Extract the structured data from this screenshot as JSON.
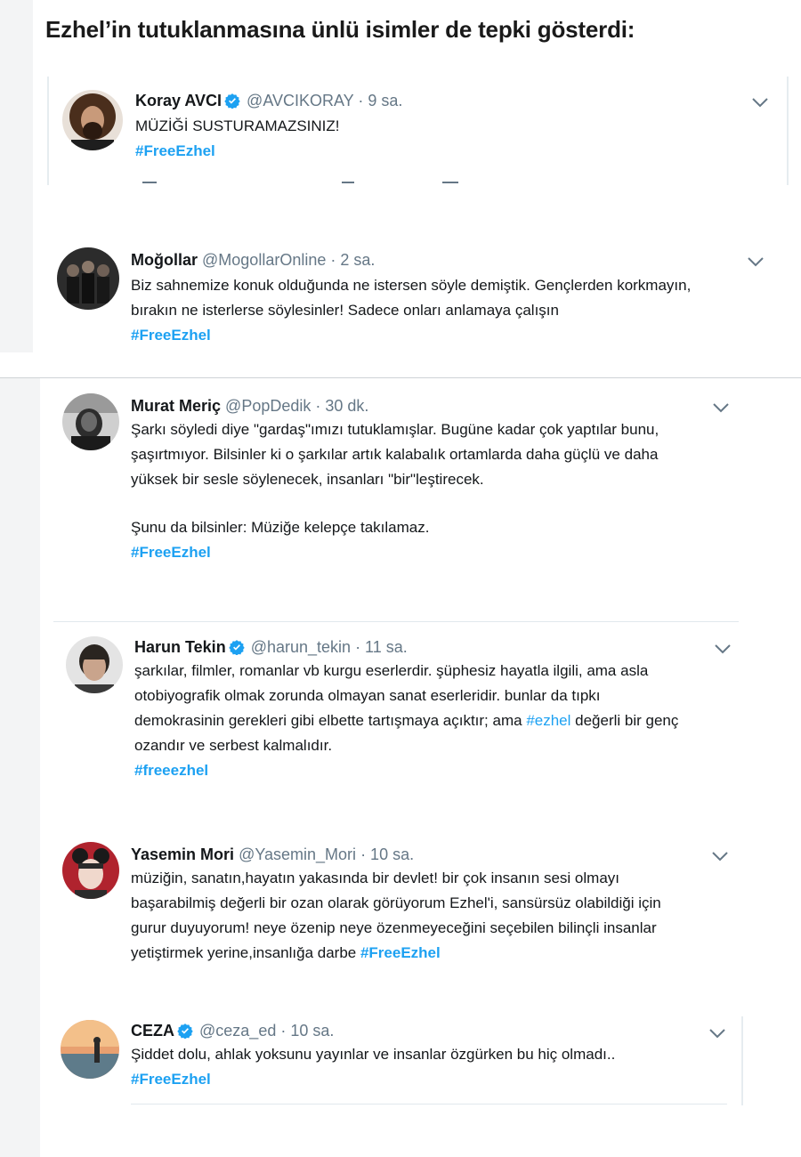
{
  "heading": "Ezhel’in tutuklanmasına ünlü isimler de tepki gösterdi:",
  "tweets": [
    {
      "name": "Koray AVCI",
      "verified": true,
      "handle": "@AVCIKORAY",
      "time": "· 9 sa.",
      "text": "MÜZİĞİ SUSTURAMAZSINIZ!",
      "hashtag": "#FreeEzhel"
    },
    {
      "name": "Moğollar",
      "verified": false,
      "handle": "@MogollarOnline",
      "time": "· 2 sa.",
      "text": "Biz sahnemize konuk olduğunda ne istersen söyle demiştik. Gençlerden korkmayın,\nbırakın ne isterlerse söylesinler! Sadece onları anlamaya çalışın",
      "hashtag": "#FreeEzhel"
    },
    {
      "name": "Murat Meriç",
      "verified": false,
      "handle": "@PopDedik",
      "time": "· 30 dk.",
      "text": "Şarkı söyledi diye \"gardaş\"ımızı tutuklamışlar. Bugüne kadar çok yaptılar bunu,\nşaşırtmıyor. Bilsinler ki o şarkılar artık kalabalık ortamlarda daha güçlü ve daha\nyüksek bir sesle söylenecek, insanları \"bir\"leştirecek.",
      "text2": "Şunu da bilsinler: Müziğe kelepçe takılamaz.",
      "hashtag": "#FreeEzhel"
    },
    {
      "name": "Harun Tekin",
      "verified": true,
      "handle": "@harun_tekin",
      "time": "· 11 sa.",
      "text_before": "şarkılar, filmler, romanlar vb kurgu eserlerdir. şüphesiz hayatla ilgili, ama asla\notobiyografik olmak zorunda olmayan sanat eserleridir. bunlar da tıpkı\ndemokrasinin gerekleri gibi elbette tartışmaya açıktır; ama ",
      "inline_tag": "#ezhel",
      "text_after": " değerli bir genç\nozandır ve serbest kalmalıdır.",
      "hashtag": "#freeezhel"
    },
    {
      "name": "Yasemin Mori",
      "verified": false,
      "handle": "@Yasemin_Mori",
      "time": "· 10 sa.",
      "text_before": "müziğin, sanatın,hayatın yakasında bir devlet! bir çok insanın sesi olmayı\nbaşarabilmiş değerli bir ozan olarak görüyorum Ezhel'i, sansürsüz olabildiği için\ngurur duyuyorum! neye özenip neye özenmeyeceğini seçebilen bilinçli insanlar\nyetiştirmek yerine,insanlığa darbe ",
      "inline_tag": "#FreeEzhel"
    },
    {
      "name": "CEZA",
      "verified": true,
      "handle": "@ceza_ed",
      "time": "· 10 sa.",
      "text": "Şiddet dolu, ahlak yoksunu yayınlar ve insanlar özgürken bu hiç olmadı..",
      "hashtag": "#FreeEzhel"
    }
  ],
  "icons": {
    "verified": "verified-badge-icon",
    "more": "chevron-down-icon"
  },
  "colors": {
    "link": "#1da1f2",
    "handle": "#657786",
    "text": "#14171a",
    "verified": "#1da1f2"
  }
}
